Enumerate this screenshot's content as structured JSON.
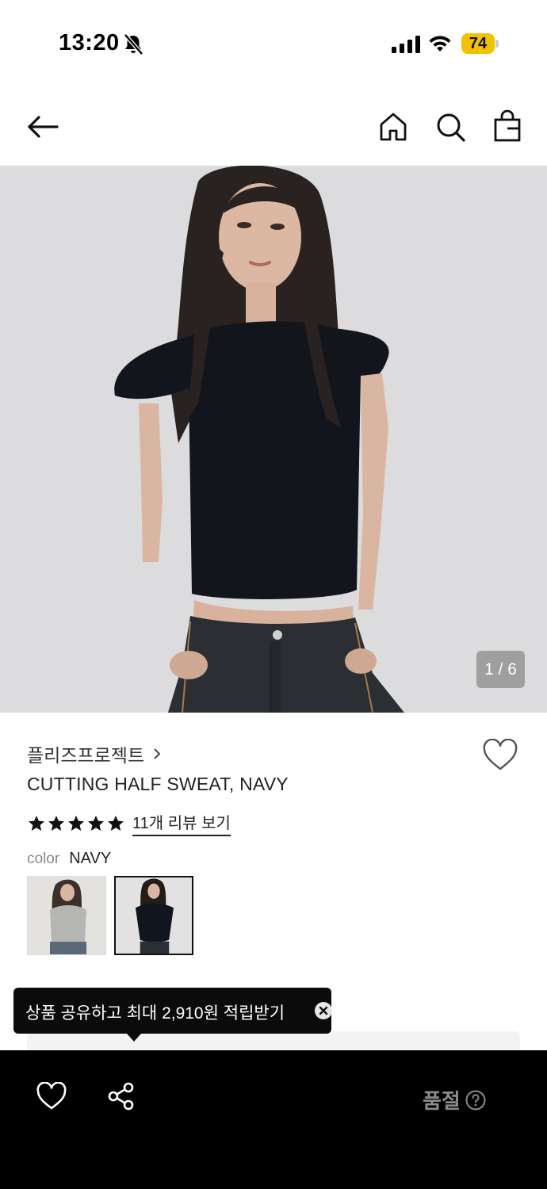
{
  "status_bar": {
    "time": "13:20",
    "battery": "74"
  },
  "header": {
    "back_icon": "arrow-left-icon",
    "home_icon": "home-icon",
    "search_icon": "search-icon",
    "bag_icon": "shopping-bag-icon"
  },
  "gallery": {
    "counter": "1 / 6"
  },
  "product": {
    "brand": "플리즈프로젝트",
    "title": "CUTTING HALF SWEAT, NAVY",
    "rating_stars": 5,
    "review_link": "11개 리뷰 보기",
    "color_label": "color",
    "color_value": "NAVY",
    "swatches": [
      {
        "color": "#b9b9b7",
        "selected": false
      },
      {
        "color": "#10151f",
        "selected": true
      }
    ]
  },
  "tooltip": {
    "text": "상품 공유하고 최대 2,910원 적립받기"
  },
  "bottom_bar": {
    "status": "품절"
  },
  "colors": {
    "battery": "#f2c200",
    "bottom_bar": "#000000",
    "sold_out_text": "#8a8a8a"
  }
}
